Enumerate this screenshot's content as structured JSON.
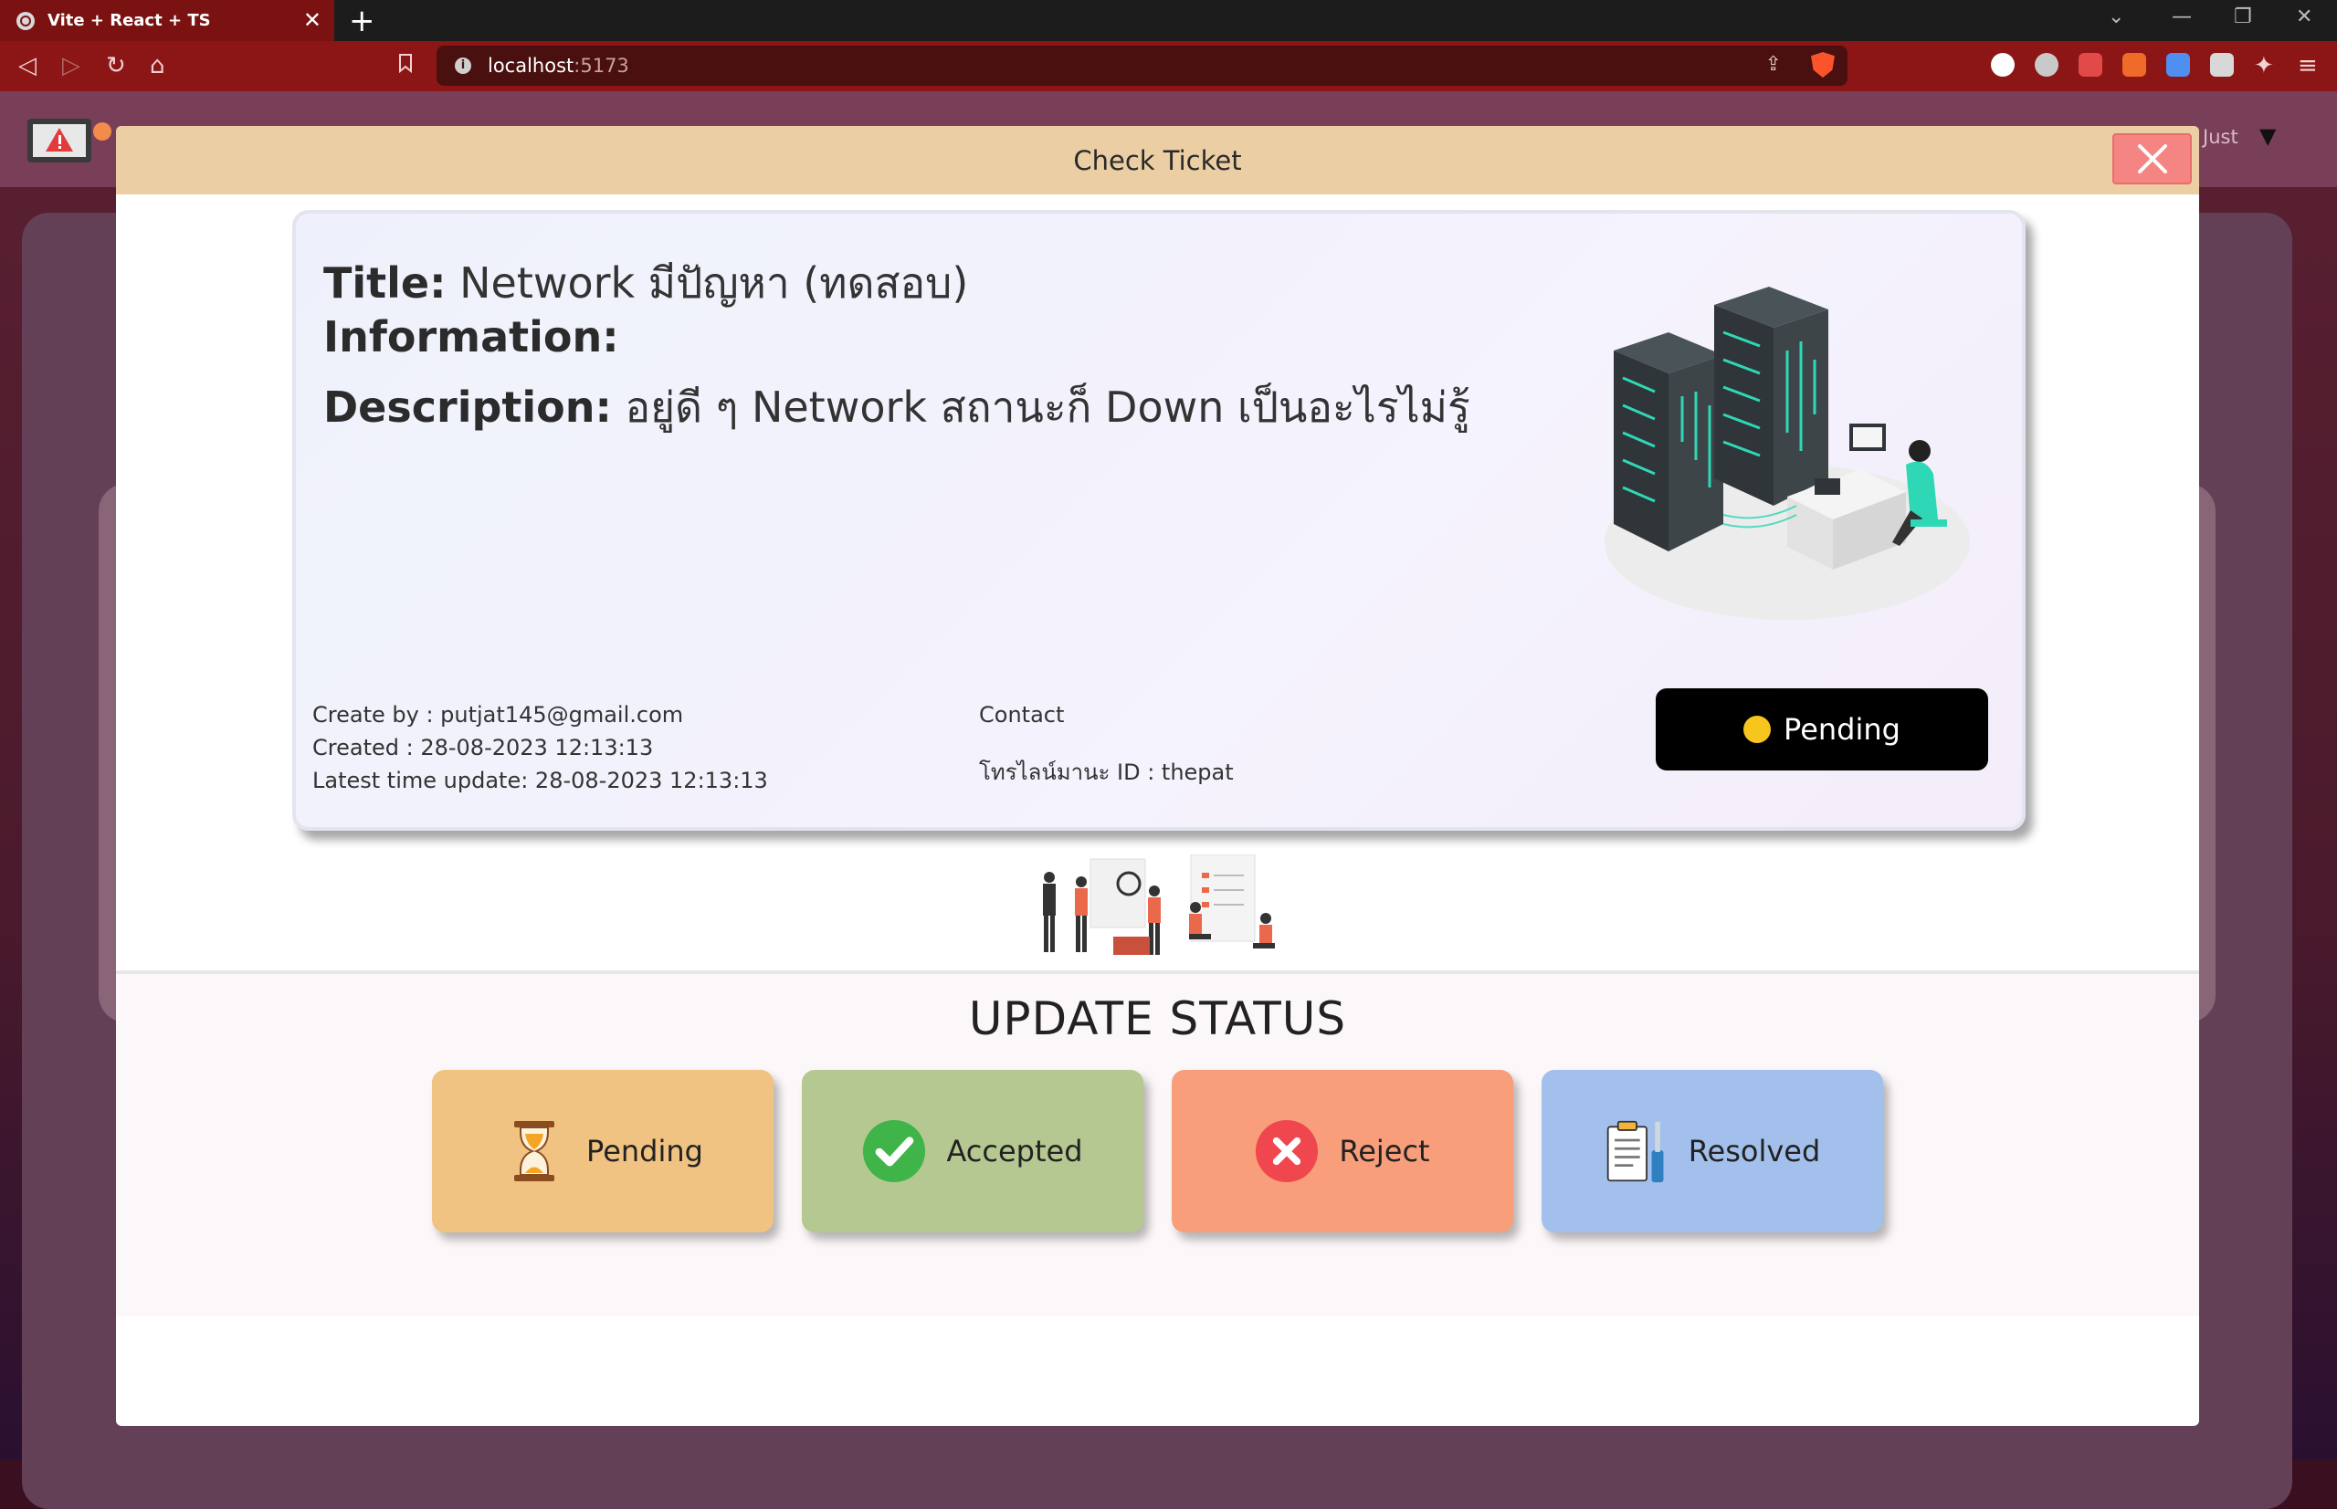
{
  "browser": {
    "tab_title": "Vite + React + TS",
    "tab_close": "✕",
    "new_tab": "+",
    "url_host": "localhost",
    "url_port": ":5173"
  },
  "app": {
    "user_name": "Just"
  },
  "modal": {
    "title": "Check Ticket",
    "ticket": {
      "title_label": "Title:",
      "title_value": "Network มีปัญหา (ทดสอบ)",
      "information_label": "Information:",
      "description_label": "Description:",
      "description_value": "อยู่ดี ๆ Network สถานะก็ Down เป็นอะไรไม่รู้",
      "create_by": "Create by : putjat145@gmail.com",
      "created": "Created : 28-08-2023 12:13:13",
      "latest_update": "Latest time update: 28-08-2023 12:13:13",
      "contact_label": "Contact",
      "contact_line": "โทรไลน์มานะ ID : thepat",
      "status": "Pending",
      "status_color": "#f7c51e"
    },
    "update_status": {
      "heading": "UPDATE STATUS",
      "buttons": [
        {
          "label": "Pending",
          "icon": "hourglass-icon",
          "color": "#f0c382"
        },
        {
          "label": "Accepted",
          "icon": "check-circle-icon",
          "color": "#b5c891"
        },
        {
          "label": "Reject",
          "icon": "x-circle-icon",
          "color": "#f89e7b"
        },
        {
          "label": "Resolved",
          "icon": "clipboard-tools-icon",
          "color": "#a3c0ec"
        }
      ]
    }
  }
}
